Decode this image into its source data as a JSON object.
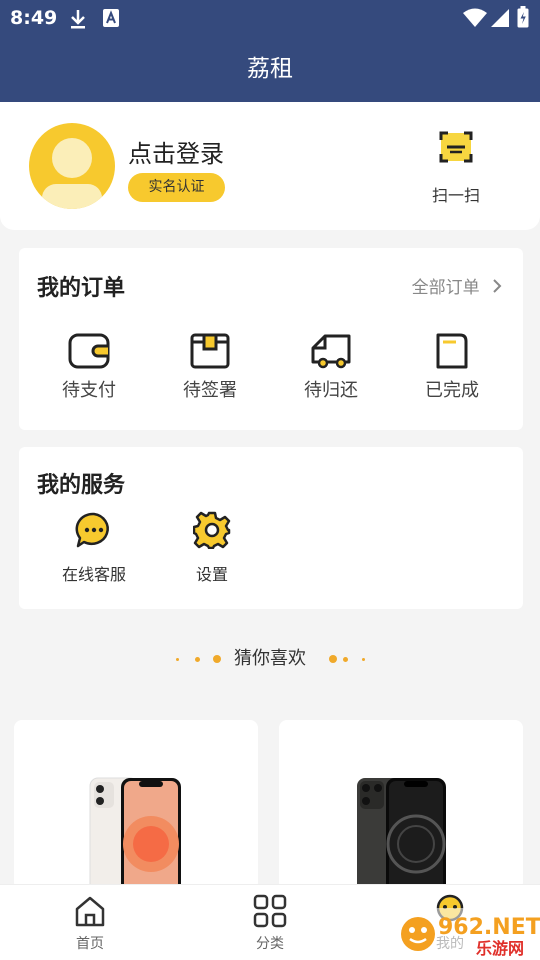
{
  "status_bar": {
    "time": "8:49"
  },
  "app_title": "荔租",
  "profile": {
    "login_text": "点击登录",
    "auth_badge": "实名认证",
    "scan_label": "扫一扫"
  },
  "orders": {
    "title": "我的订单",
    "all_orders": "全部订单",
    "items": [
      {
        "label": "待支付",
        "icon": "wallet-icon"
      },
      {
        "label": "待签署",
        "icon": "package-icon"
      },
      {
        "label": "待归还",
        "icon": "truck-icon"
      },
      {
        "label": "已完成",
        "icon": "document-icon"
      }
    ]
  },
  "services": {
    "title": "我的服务",
    "items": [
      {
        "label": "在线客服",
        "icon": "chat-icon"
      },
      {
        "label": "设置",
        "icon": "gear-icon"
      }
    ]
  },
  "guess": {
    "title": "猜你喜欢"
  },
  "tabs": [
    {
      "label": "首页",
      "icon": "home-icon"
    },
    {
      "label": "分类",
      "icon": "grid-icon"
    },
    {
      "label": "我的",
      "icon": "profile-icon"
    }
  ],
  "watermark": {
    "brand": "962.NET",
    "sub": "乐游网"
  },
  "colors": {
    "header": "#354a7d",
    "accent": "#f7c92e",
    "background": "#f4f4f4"
  }
}
